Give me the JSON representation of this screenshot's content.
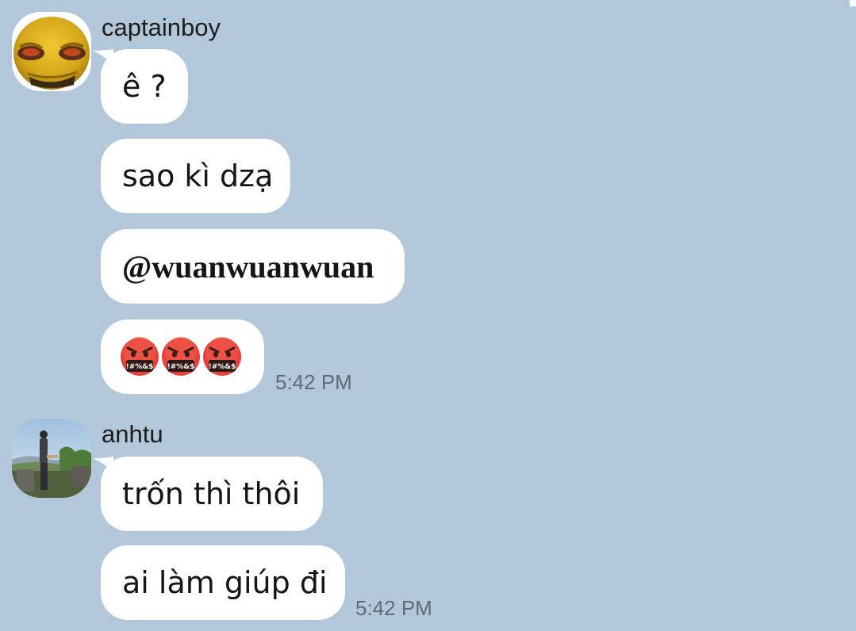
{
  "conversation": {
    "groups": [
      {
        "sender": "captainboy",
        "avatar_icon": "yellow-cartoon-face-avatar",
        "messages": [
          {
            "text": "ê ?"
          },
          {
            "text": "sao kì dzạ"
          },
          {
            "text": "@wuanwuanwuan"
          },
          {
            "emoji": [
              "face-with-symbols-on-mouth",
              "face-with-symbols-on-mouth",
              "face-with-symbols-on-mouth"
            ],
            "emoji_symbols": "!#%&$"
          }
        ],
        "time": "5:42 PM"
      },
      {
        "sender": "anhtu",
        "avatar_icon": "landscape-photo-avatar",
        "messages": [
          {
            "text": "trốn thì thôi"
          },
          {
            "text": "ai làm giúp đi"
          }
        ],
        "time": "5:42 PM"
      }
    ]
  },
  "colors": {
    "background": "#b2c7da",
    "bubble": "#ffffff",
    "emoji_face": "#e8403a",
    "timestamp": "#5f6b77"
  }
}
